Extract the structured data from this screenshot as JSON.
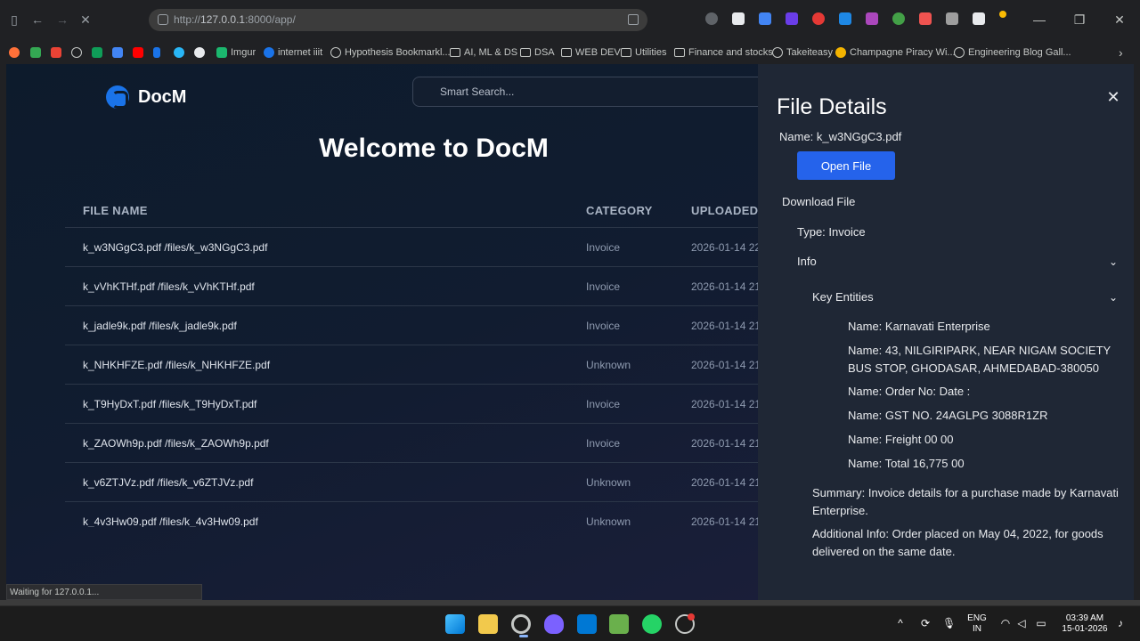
{
  "browser": {
    "url_prefix": "http://",
    "url_host": "127.0.0.1",
    "url_rest": ":8000/app/",
    "status_text": "Waiting for 127.0.0.1...",
    "bookmarks": [
      {
        "label": "Imgur",
        "icon": "imgur-icon"
      },
      {
        "label": "internet iiit",
        "icon": "s-icon"
      },
      {
        "label": "Hypothesis Bookmarkl...",
        "icon": "globe-icon"
      },
      {
        "label": "AI, ML & DS",
        "icon": "folder-icon"
      },
      {
        "label": "DSA",
        "icon": "folder-icon"
      },
      {
        "label": "WEB DEV",
        "icon": "folder-icon"
      },
      {
        "label": "Utilities",
        "icon": "folder-icon"
      },
      {
        "label": "Finance and stocks",
        "icon": "folder-icon"
      },
      {
        "label": "Takeiteasy",
        "icon": "globe-icon"
      },
      {
        "label": "Champagne Piracy Wi...",
        "icon": "champagne-icon"
      },
      {
        "label": "Engineering Blog Gall...",
        "icon": "globe-icon"
      }
    ]
  },
  "app": {
    "logo_text": "DocM",
    "search_placeholder": "Smart Search...",
    "welcome": "Welcome to DocM",
    "columns": {
      "name": "FILE NAME",
      "category": "CATEGORY",
      "uploaded": "UPLOADED ..."
    },
    "files": [
      {
        "name": "k_w3NGgC3.pdf /files/k_w3NGgC3.pdf",
        "category": "Invoice",
        "uploaded": "2026-01-14 22"
      },
      {
        "name": "k_vVhKTHf.pdf /files/k_vVhKTHf.pdf",
        "category": "Invoice",
        "uploaded": "2026-01-14 21"
      },
      {
        "name": "k_jadle9k.pdf /files/k_jadle9k.pdf",
        "category": "Invoice",
        "uploaded": "2026-01-14 21"
      },
      {
        "name": "k_NHKHFZE.pdf /files/k_NHKHFZE.pdf",
        "category": "Unknown",
        "uploaded": "2026-01-14 21"
      },
      {
        "name": "k_T9HyDxT.pdf /files/k_T9HyDxT.pdf",
        "category": "Invoice",
        "uploaded": "2026-01-14 21"
      },
      {
        "name": "k_ZAOWh9p.pdf /files/k_ZAOWh9p.pdf",
        "category": "Invoice",
        "uploaded": "2026-01-14 21"
      },
      {
        "name": "k_v6ZTJVz.pdf /files/k_v6ZTJVz.pdf",
        "category": "Unknown",
        "uploaded": "2026-01-14 21"
      },
      {
        "name": "k_4v3Hw09.pdf /files/k_4v3Hw09.pdf",
        "category": "Unknown",
        "uploaded": "2026-01-14 21"
      }
    ]
  },
  "panel": {
    "title": "File Details",
    "name_line": "Name: k_w3NGgC3.pdf",
    "open_button": "Open File",
    "download": "Download File",
    "type_line": "Type: Invoice",
    "info": "Info",
    "key_entities": "Key Entities",
    "entities": [
      "Name: Karnavati Enterprise",
      "Name: 43, NILGIRIPARK, NEAR NIGAM SOCIETY BUS STOP, GHODASAR, AHMEDABAD-380050",
      "Name: Order No: Date :",
      "Name: GST NO. 24AGLPG 3088R1ZR",
      "Name: Freight 00 00",
      "Name: Total 16,775 00"
    ],
    "summary": "Summary: Invoice details for a purchase made by Karnavati Enterprise.",
    "additional": "Additional Info: Order placed on May 04, 2022, for goods delivered on the same date."
  },
  "taskbar": {
    "lang_top": "ENG",
    "lang_bottom": "IN",
    "time": "03:39 AM",
    "date": "15-01-2026"
  }
}
